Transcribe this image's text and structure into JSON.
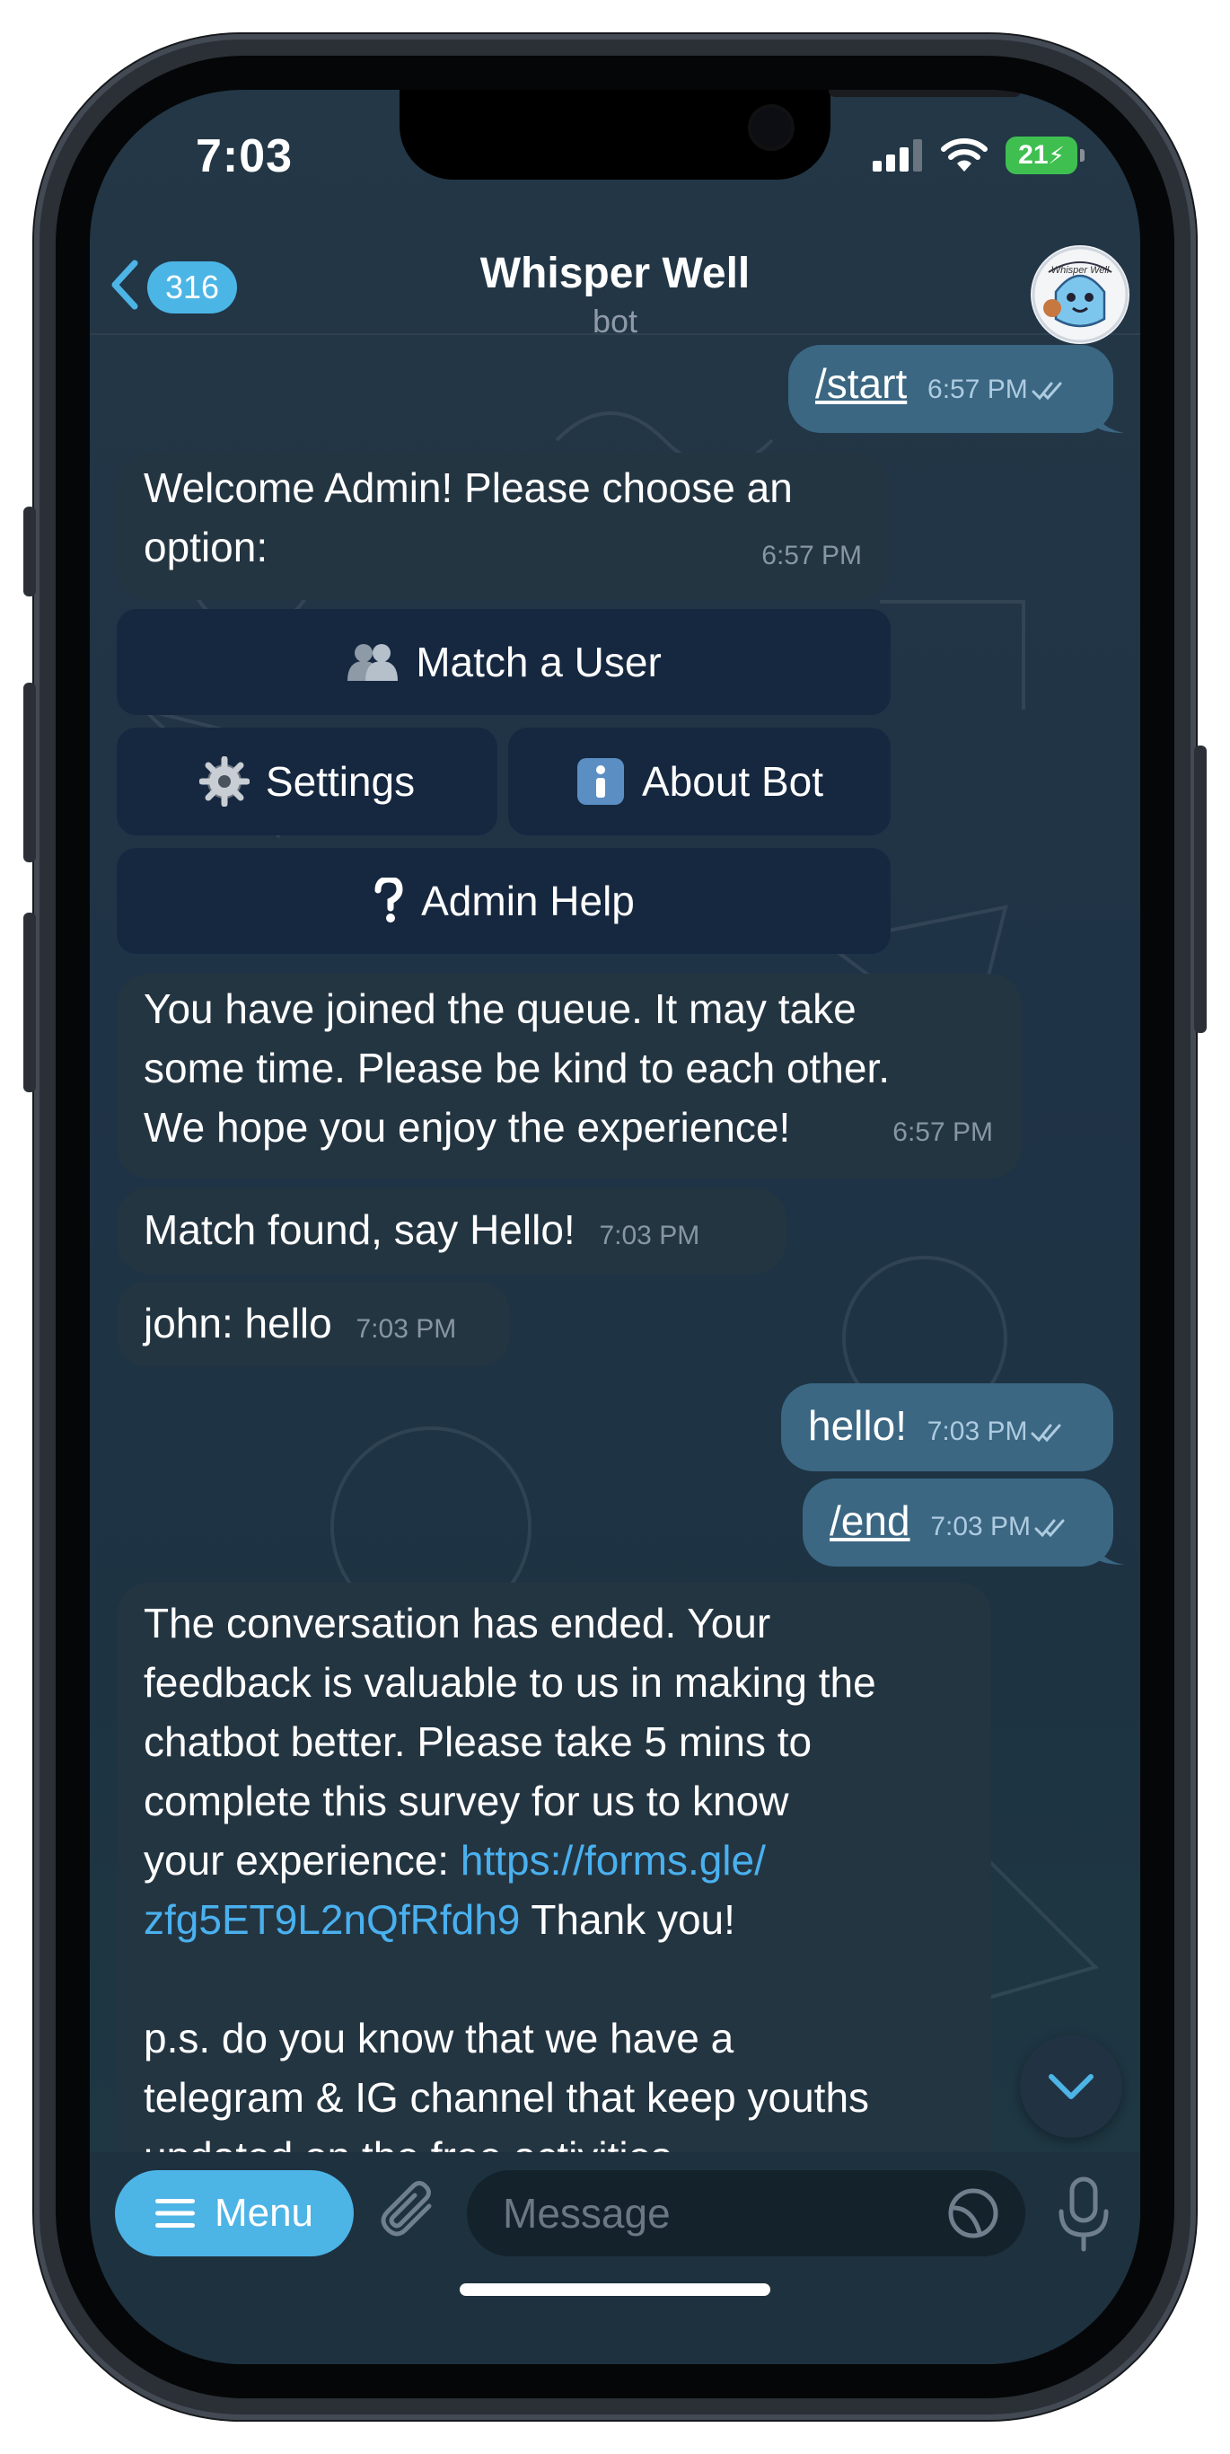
{
  "status": {
    "time": "7:03",
    "battery": "21"
  },
  "header": {
    "back_count": "316",
    "title": "Whisper Well",
    "subtitle": "bot",
    "avatar_text": "Whisper Well"
  },
  "messages": {
    "m1": {
      "text": "/start",
      "time": "6:57 PM"
    },
    "m2": {
      "text": "Welcome Admin! Please choose an\noption:",
      "time": "6:57 PM"
    },
    "keyboard": {
      "match": "Match a User",
      "settings": "Settings",
      "about": "About Bot",
      "help": "Admin Help"
    },
    "m3": {
      "text": "You have joined the queue. It may take\nsome time. Please be kind to each other.\nWe hope you enjoy the experience!",
      "time": "6:57 PM"
    },
    "m4": {
      "text": "Match found, say Hello!",
      "time": "7:03 PM"
    },
    "m5": {
      "text": "john: hello",
      "time": "7:03 PM"
    },
    "m6": {
      "text": "hello!",
      "time": "7:03 PM"
    },
    "m7": {
      "text": "/end",
      "time": "7:03 PM"
    },
    "m8": {
      "part1": "The conversation has ended. Your\nfeedback is valuable to us in making the\nchatbot better. Please take 5 mins to\ncomplete this survey for us to know\nyour experience: ",
      "link": "https://forms.gle/\nzfg5ET9L2nQfRfdh9",
      "part2": " Thank you!\n\np.s. do you know that we have a\ntelegram & IG channel that keep youths\nupdated on the free activities..."
    }
  },
  "input": {
    "menu_label": "Menu",
    "placeholder": "Message"
  },
  "colors": {
    "accent": "#4db4e6",
    "outgoing_bubble": "#3b6783",
    "incoming_bubble": "#243542",
    "link": "#4ab1ef"
  }
}
